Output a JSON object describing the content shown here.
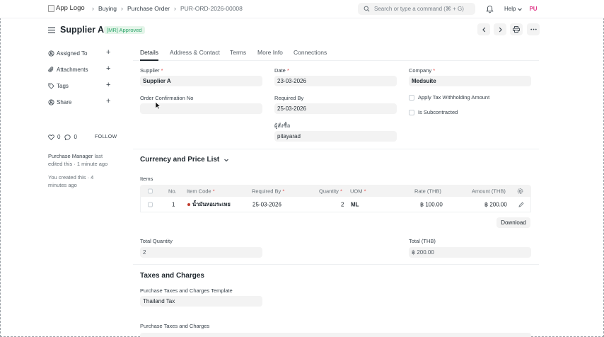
{
  "navbar": {
    "logo_alt": "App Logo",
    "breadcrumbs": [
      "Buying",
      "Purchase Order",
      "PUR-ORD-2026-00008"
    ],
    "search_placeholder": "Search or type a command (⌘ + G)",
    "help_label": "Help",
    "avatar_initials": "PU"
  },
  "header": {
    "title": "Supplier A",
    "status_badge": "[MR] Approved"
  },
  "sidebar": {
    "items": [
      {
        "label": "Assigned To",
        "icon": "assign-icon"
      },
      {
        "label": "Attachments",
        "icon": "paperclip-icon"
      },
      {
        "label": "Tags",
        "icon": "tag-icon"
      },
      {
        "label": "Share",
        "icon": "share-icon"
      }
    ],
    "likes": "0",
    "comments": "0",
    "follow_label": "FOLLOW",
    "activity": [
      {
        "actor": "Purchase Manager",
        "text": " last edited this · 1 minute ago"
      },
      {
        "actor": "",
        "text": "You created this · 4 minutes ago"
      }
    ]
  },
  "tabs": [
    "Details",
    "Address & Contact",
    "Terms",
    "More Info",
    "Connections"
  ],
  "form": {
    "supplier_label": "Supplier",
    "supplier_value": "Supplier A",
    "date_label": "Date",
    "date_value": "23-03-2026",
    "company_label": "Company",
    "company_value": "Medsuite",
    "order_conf_label": "Order Confirmation No",
    "order_conf_value": "",
    "required_by_label": "Required By",
    "required_by_value": "25-03-2026",
    "buyer_label": "ผู้สั่งซื้อ",
    "buyer_value": "pitayarad",
    "apply_tax_label": "Apply Tax Withholding Amount",
    "subcontracted_label": "Is Subcontracted"
  },
  "currency_section": {
    "title": "Currency and Price List"
  },
  "items_table": {
    "label": "Items",
    "headers": {
      "no": "No.",
      "item_code": "Item Code",
      "required_by": "Required By",
      "quantity": "Quantity",
      "uom": "UOM",
      "rate": "Rate (THB)",
      "amount": "Amount (THB)"
    },
    "rows": [
      {
        "no": "1",
        "item_code": "น้ำมันหอมระเหย",
        "required_by": "25-03-2026",
        "quantity": "2",
        "uom": "ML",
        "rate": "฿ 100.00",
        "amount": "฿ 200.00"
      }
    ],
    "download_label": "Download"
  },
  "totals": {
    "total_qty_label": "Total Quantity",
    "total_qty_value": "2",
    "total_label": "Total (THB)",
    "total_value": "฿ 200.00"
  },
  "taxes_section": {
    "title": "Taxes and Charges",
    "template_label": "Purchase Taxes and Charges Template",
    "template_value": "Thailand Tax",
    "table_label": "Purchase Taxes and Charges"
  },
  "colors": {
    "badge_bg": "#e4f5e9",
    "badge_text": "#30a66d",
    "required_star": "#e24c4c",
    "avatar_text": "#e03a8a"
  }
}
